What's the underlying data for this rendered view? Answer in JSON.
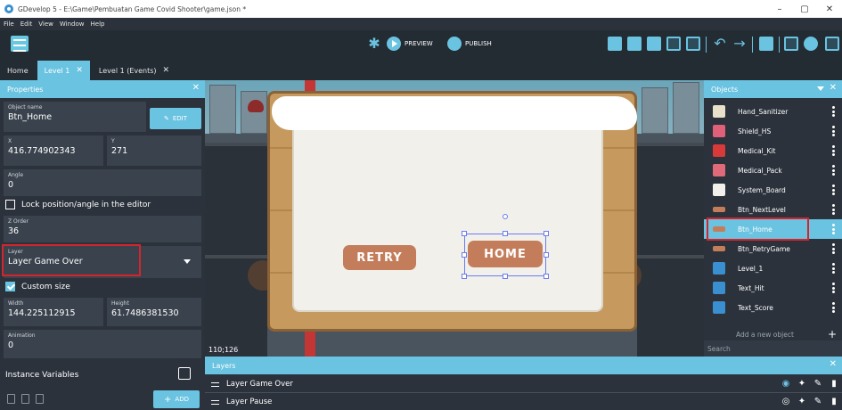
{
  "window": {
    "title": "GDevelop 5 - E:\\Game\\Pembuatan Game Covid Shooter\\game.json *",
    "controls": [
      "–",
      "▢",
      "✕"
    ]
  },
  "menu": [
    "File",
    "Edit",
    "View",
    "Window",
    "Help"
  ],
  "toolbar": {
    "preview_label": "PREVIEW",
    "publish_label": "PUBLISH"
  },
  "tabs": [
    {
      "label": "Home",
      "closable": false
    },
    {
      "label": "Level 1",
      "closable": true,
      "active": true
    },
    {
      "label": "Level 1 (Events)",
      "closable": true
    }
  ],
  "properties": {
    "title": "Properties",
    "object_name_label": "Object name",
    "object_name_value": "Btn_Home",
    "edit_label": "EDIT",
    "x_label": "X",
    "x_value": "416.774902343",
    "y_label": "Y",
    "y_value": "271",
    "angle_label": "Angle",
    "angle_value": "0",
    "lock_label": "Lock position/angle in the editor",
    "zorder_label": "Z Order",
    "zorder_value": "36",
    "layer_label": "Layer",
    "layer_value": "Layer Game Over",
    "custom_size_label": "Custom size",
    "width_label": "Width",
    "width_value": "144.225112915",
    "height_label": "Height",
    "height_value": "61.7486381530",
    "animation_label": "Animation",
    "animation_value": "0",
    "instance_vars_label": "Instance Variables",
    "add_label": "ADD"
  },
  "scene": {
    "retry_label": "RETRY",
    "home_label": "HOME",
    "coords": "110;126"
  },
  "objects": {
    "title": "Objects",
    "items": [
      {
        "name": "Hand_Sanitizer",
        "color": "#e8e0c8"
      },
      {
        "name": "Shield_HS",
        "color": "#e0607a"
      },
      {
        "name": "Medical_Kit",
        "color": "#d83a3a"
      },
      {
        "name": "Medical_Pack",
        "color": "#e06a7a"
      },
      {
        "name": "System_Board",
        "color": "#f2f0ea"
      },
      {
        "name": "Btn_NextLevel",
        "color": "#c47d5b"
      },
      {
        "name": "Btn_Home",
        "color": "#c47d5b",
        "selected": true
      },
      {
        "name": "Btn_RetryGame",
        "color": "#c47d5b"
      },
      {
        "name": "Level_1",
        "color": "#3a8fd0"
      },
      {
        "name": "Text_Hit",
        "color": "#3a8fd0"
      },
      {
        "name": "Text_Score",
        "color": "#3a8fd0"
      }
    ],
    "add_new_label": "Add a new object",
    "search_placeholder": "Search"
  },
  "layers": {
    "title": "Layers",
    "items": [
      {
        "name": "Layer Game Over"
      },
      {
        "name": "Layer Pause"
      }
    ]
  },
  "colors": {
    "accent": "#6ac3e0",
    "highlight": "#d6242c",
    "panel": "#2b323c"
  }
}
